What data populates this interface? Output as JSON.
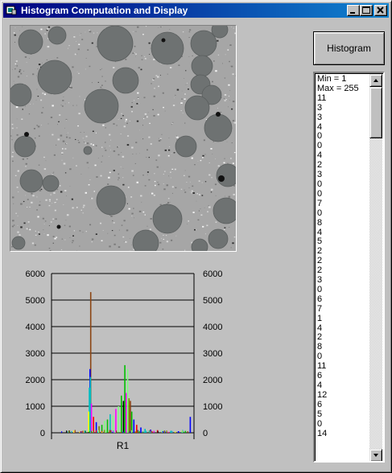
{
  "window": {
    "title": "Histogram Computation and Display",
    "buttons": {
      "minimize": "_",
      "maximize": "□",
      "close": "✕"
    }
  },
  "image": {
    "description_icon": "micrograph-image"
  },
  "histogram_button": {
    "label": "Histogram"
  },
  "listbox": {
    "items": [
      "Min = 1",
      "Max = 255",
      "11",
      "3",
      "3",
      "4",
      "0",
      "0",
      "4",
      "2",
      "3",
      "0",
      "0",
      "7",
      "0",
      "8",
      "4",
      "5",
      "2",
      "2",
      "2",
      "3",
      "0",
      "6",
      "7",
      "1",
      "4",
      "2",
      "8",
      "0",
      "11",
      "6",
      "4",
      "12",
      "6",
      "5",
      "0",
      "14"
    ]
  },
  "chart_data": {
    "type": "bar",
    "title": "",
    "categories": [
      "R1"
    ],
    "xlabel": "",
    "ylabel": "",
    "ylim": [
      0,
      6000
    ],
    "y_ticks": [
      "0",
      "1000",
      "2000",
      "3000",
      "4000",
      "5000",
      "6000"
    ],
    "y2_ticks": [
      "0",
      "1000",
      "2000",
      "3000",
      "4000",
      "5000",
      "6000"
    ],
    "grid": true,
    "series_colors": [
      "#ff0000",
      "#00c000",
      "#0000ff",
      "#ff00ff",
      "#00c0c0",
      "#808000",
      "#80ff80",
      "#000000",
      "#8b4513",
      "#ffff00"
    ],
    "peaks": [
      {
        "x": 0.27,
        "v": 5300,
        "c": 8
      },
      {
        "x": 0.265,
        "v": 2400,
        "c": 2
      },
      {
        "x": 0.268,
        "v": 2100,
        "c": 4
      },
      {
        "x": 0.26,
        "v": 1700,
        "c": 4
      },
      {
        "x": 0.255,
        "v": 800,
        "c": 9
      },
      {
        "x": 0.275,
        "v": 1100,
        "c": 3
      },
      {
        "x": 0.29,
        "v": 600,
        "c": 0
      },
      {
        "x": 0.31,
        "v": 400,
        "c": 2
      },
      {
        "x": 0.33,
        "v": 250,
        "c": 5
      },
      {
        "x": 0.35,
        "v": 300,
        "c": 1
      },
      {
        "x": 0.37,
        "v": 450,
        "c": 6
      },
      {
        "x": 0.39,
        "v": 500,
        "c": 1
      },
      {
        "x": 0.41,
        "v": 700,
        "c": 4
      },
      {
        "x": 0.43,
        "v": 650,
        "c": 6
      },
      {
        "x": 0.45,
        "v": 900,
        "c": 3
      },
      {
        "x": 0.47,
        "v": 1000,
        "c": 6
      },
      {
        "x": 0.49,
        "v": 1400,
        "c": 1
      },
      {
        "x": 0.505,
        "v": 1200,
        "c": 7
      },
      {
        "x": 0.515,
        "v": 2550,
        "c": 1
      },
      {
        "x": 0.525,
        "v": 1500,
        "c": 3
      },
      {
        "x": 0.535,
        "v": 2400,
        "c": 6
      },
      {
        "x": 0.545,
        "v": 1300,
        "c": 5
      },
      {
        "x": 0.555,
        "v": 1200,
        "c": 8
      },
      {
        "x": 0.565,
        "v": 800,
        "c": 1
      },
      {
        "x": 0.58,
        "v": 500,
        "c": 2
      },
      {
        "x": 0.6,
        "v": 300,
        "c": 0
      },
      {
        "x": 0.63,
        "v": 200,
        "c": 2
      },
      {
        "x": 0.66,
        "v": 150,
        "c": 4
      },
      {
        "x": 0.7,
        "v": 120,
        "c": 2
      },
      {
        "x": 0.75,
        "v": 100,
        "c": 0
      },
      {
        "x": 0.8,
        "v": 80,
        "c": 2
      },
      {
        "x": 0.85,
        "v": 60,
        "c": 3
      },
      {
        "x": 0.9,
        "v": 60,
        "c": 2
      },
      {
        "x": 0.95,
        "v": 70,
        "c": 1
      },
      {
        "x": 0.985,
        "v": 600,
        "c": 2
      },
      {
        "x": 0.1,
        "v": 40,
        "c": 0
      },
      {
        "x": 0.15,
        "v": 50,
        "c": 3
      },
      {
        "x": 0.2,
        "v": 60,
        "c": 0
      },
      {
        "x": 0.23,
        "v": 80,
        "c": 2
      }
    ]
  },
  "micrograph": {
    "background": "#a6a6a6",
    "particle_color": "#6e7272",
    "particles": [
      {
        "cx": 25,
        "cy": 20,
        "r": 15
      },
      {
        "cx": 58,
        "cy": 12,
        "r": 11
      },
      {
        "cx": 130,
        "cy": 22,
        "r": 22
      },
      {
        "cx": 195,
        "cy": 28,
        "r": 20
      },
      {
        "cx": 240,
        "cy": 22,
        "r": 16
      },
      {
        "cx": 260,
        "cy": 5,
        "r": 10
      },
      {
        "cx": 55,
        "cy": 64,
        "r": 21
      },
      {
        "cx": 113,
        "cy": 100,
        "r": 21
      },
      {
        "cx": 143,
        "cy": 68,
        "r": 16
      },
      {
        "cx": 238,
        "cy": 50,
        "r": 13
      },
      {
        "cx": 236,
        "cy": 73,
        "r": 12
      },
      {
        "cx": 250,
        "cy": 86,
        "r": 12
      },
      {
        "cx": 232,
        "cy": 102,
        "r": 15
      },
      {
        "cx": 258,
        "cy": 127,
        "r": 17
      },
      {
        "cx": 12,
        "cy": 86,
        "r": 14
      },
      {
        "cx": 18,
        "cy": 150,
        "r": 13
      },
      {
        "cx": 26,
        "cy": 193,
        "r": 14
      },
      {
        "cx": 50,
        "cy": 196,
        "r": 10
      },
      {
        "cx": 218,
        "cy": 150,
        "r": 13
      },
      {
        "cx": 270,
        "cy": 186,
        "r": 14
      },
      {
        "cx": 125,
        "cy": 217,
        "r": 18
      },
      {
        "cx": 195,
        "cy": 240,
        "r": 18
      },
      {
        "cx": 268,
        "cy": 230,
        "r": 16
      },
      {
        "cx": 258,
        "cy": 265,
        "r": 12
      },
      {
        "cx": 168,
        "cy": 270,
        "r": 16
      },
      {
        "cx": 235,
        "cy": 275,
        "r": 10
      },
      {
        "cx": 10,
        "cy": 270,
        "r": 8
      },
      {
        "cx": 96,
        "cy": 155,
        "r": 5
      }
    ]
  }
}
